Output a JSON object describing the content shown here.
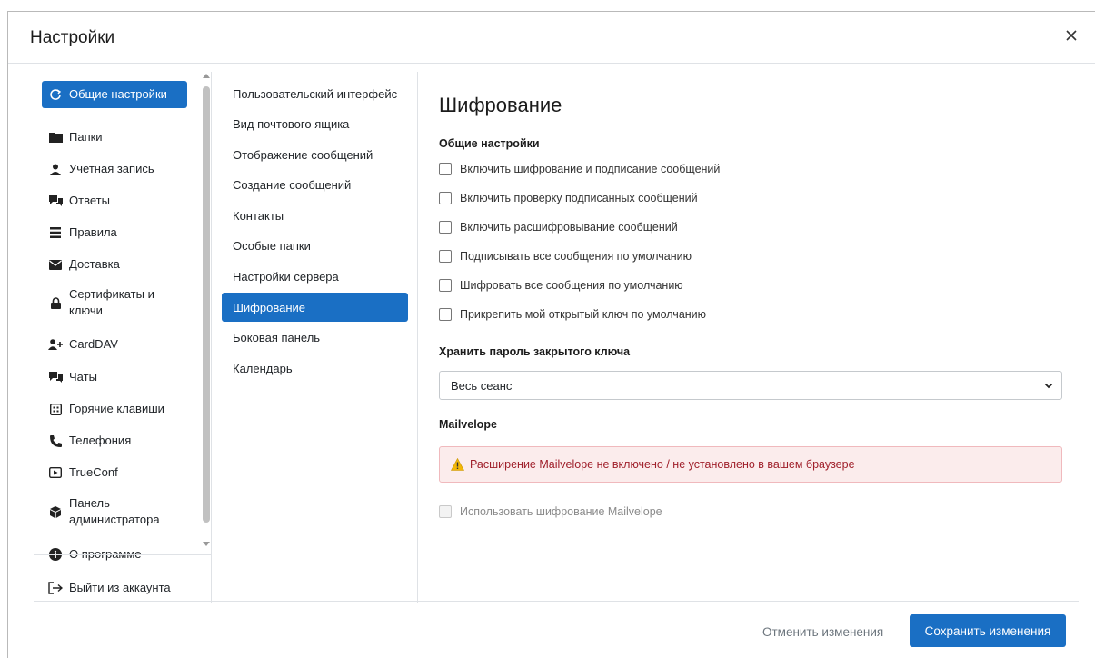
{
  "dialog": {
    "title": "Настройки"
  },
  "left_menu": {
    "items": [
      {
        "label": "Общие настройки",
        "icon": "refresh-icon",
        "active": true
      },
      {
        "label": "Папки",
        "icon": "folder-icon"
      },
      {
        "label": "Учетная запись",
        "icon": "person-icon"
      },
      {
        "label": "Ответы",
        "icon": "chat-reply-icon"
      },
      {
        "label": "Правила",
        "icon": "rules-icon"
      },
      {
        "label": "Доставка",
        "icon": "envelope-icon"
      },
      {
        "label": "Сертификаты и ключи",
        "icon": "lock-icon"
      },
      {
        "label": "CardDAV",
        "icon": "add-person-icon"
      },
      {
        "label": "Чаты",
        "icon": "chats-icon"
      },
      {
        "label": "Горячие клавиши",
        "icon": "keyboard-icon"
      },
      {
        "label": "Телефония",
        "icon": "phone-icon"
      },
      {
        "label": "TrueConf",
        "icon": "video-icon"
      },
      {
        "label": "Панель администратора",
        "icon": "admin-icon"
      },
      {
        "label": "О программе",
        "icon": "info-icon"
      }
    ],
    "logout_label": "Выйти из аккаунта"
  },
  "sub_nav": {
    "items": [
      {
        "label": "Пользовательский интерфейс"
      },
      {
        "label": "Вид почтового ящика"
      },
      {
        "label": "Отображение сообщений"
      },
      {
        "label": "Создание сообщений"
      },
      {
        "label": "Контакты"
      },
      {
        "label": "Особые папки"
      },
      {
        "label": "Настройки сервера"
      },
      {
        "label": "Шифрование",
        "active": true
      },
      {
        "label": "Боковая панель"
      },
      {
        "label": "Календарь"
      }
    ]
  },
  "content": {
    "title": "Шифрование",
    "general_heading": "Общие настройки",
    "checkboxes": [
      {
        "label": "Включить шифрование и подписание сообщений",
        "checked": false
      },
      {
        "label": "Включить проверку подписанных сообщений",
        "checked": false
      },
      {
        "label": "Включить расшифровывание сообщений",
        "checked": false
      },
      {
        "label": "Подписывать все сообщения по умолчанию",
        "checked": false
      },
      {
        "label": "Шифровать все сообщения по умолчанию",
        "checked": false
      },
      {
        "label": "Прикрепить мой открытый ключ по умолчанию",
        "checked": false
      }
    ],
    "key_password_heading": "Хранить пароль закрытого ключа",
    "key_password_select": "Весь сеанс",
    "mailvelope_heading": "Mailvelope",
    "mailvelope_alert": "Расширение Mailvelope не включено / не установлено в вашем браузере",
    "mailvelope_checkbox": {
      "label": "Использовать шифрование Mailvelope",
      "checked": false,
      "disabled": true
    }
  },
  "footer": {
    "cancel_label": "Отменить изменения",
    "save_label": "Сохранить изменения"
  },
  "colors": {
    "accent": "#1a6fc4",
    "alert_text": "#a0202b",
    "alert_bg": "#fbecec",
    "warning": "#f2b707"
  }
}
